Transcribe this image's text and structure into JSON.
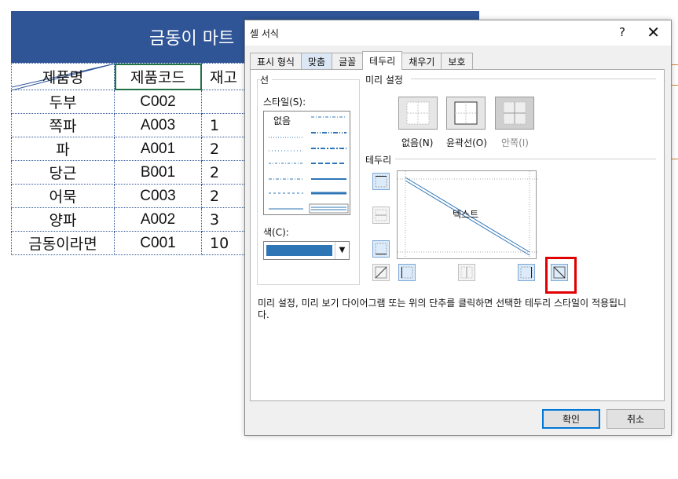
{
  "sheet": {
    "title": "금동이 마트",
    "headers": [
      "제품명",
      "제품코드",
      "재고"
    ],
    "rows": [
      {
        "name": "두부",
        "code": "C002",
        "stock": ""
      },
      {
        "name": "쪽파",
        "code": "A003",
        "stock": "1"
      },
      {
        "name": "파",
        "code": "A001",
        "stock": "2"
      },
      {
        "name": "당근",
        "code": "B001",
        "stock": "2"
      },
      {
        "name": "어묵",
        "code": "C003",
        "stock": "2"
      },
      {
        "name": "양파",
        "code": "A002",
        "stock": "3"
      },
      {
        "name": "금동이라면",
        "code": "C001",
        "stock": "10"
      }
    ],
    "banner_color": "#2f5597"
  },
  "dialog": {
    "title": "셀 서식",
    "help": "?",
    "close": "✕",
    "tabs": [
      "표시 형식",
      "맞춤",
      "글꼴",
      "테두리",
      "채우기",
      "보호"
    ],
    "active_tab": "테두리",
    "line_group": "선",
    "style_label": "스타일(S):",
    "style_none": "없음",
    "color_label": "색(C):",
    "color_value": "#2e75b6",
    "preset_group": "미리 설정",
    "presets": [
      "없음(N)",
      "윤곽선(O)",
      "안쪽(I)"
    ],
    "border_group": "테두리",
    "preview_text": "텍스트",
    "description": "미리 설정, 미리 보기 다이어그램 또는 위의 단추를 클릭하면 선택한 테두리 스타일이 적용됩니다.",
    "ok": "확인",
    "cancel": "취소"
  },
  "highlight_color": "#e00000"
}
